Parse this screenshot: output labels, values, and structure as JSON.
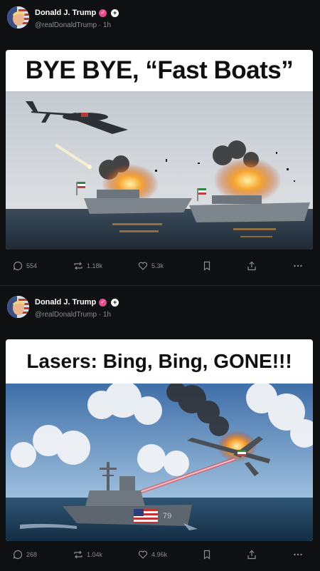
{
  "posts": [
    {
      "author": "Donald J. Trump",
      "handle": "@realDonaldTrump · 1h",
      "headline": "BYE BYE, “Fast Boats”",
      "stats": {
        "replies": "554",
        "reposts": "1.18k",
        "likes": "5.3k"
      }
    },
    {
      "author": "Donald J. Trump",
      "handle": "@realDonaldTrump · 1h",
      "headline": "Lasers: Bing, Bing, GONE!!!",
      "stats": {
        "replies": "268",
        "reposts": "1.04k",
        "likes": "4.96k"
      }
    }
  ],
  "icons": {
    "verified": "verified-badge-icon",
    "follow": "follow-plus-icon",
    "reply": "reply-icon",
    "repost": "repost-icon",
    "like": "heart-icon",
    "bookmark": "bookmark-icon",
    "share": "share-icon",
    "more": "more-icon"
  },
  "colors": {
    "background": "#0f1012",
    "verified": "#e84a8c",
    "muted": "#8a8d94"
  }
}
